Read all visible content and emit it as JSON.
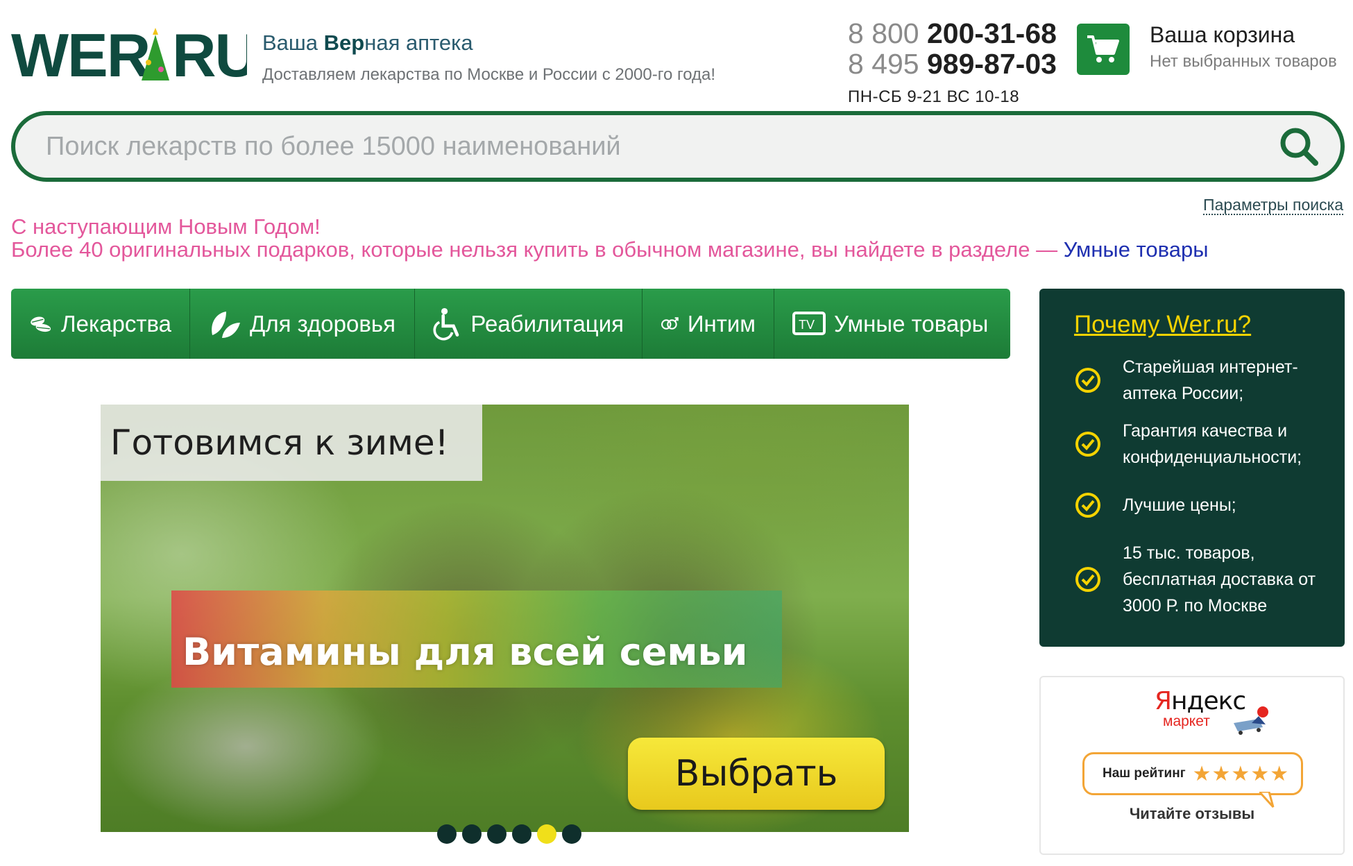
{
  "header": {
    "logo_text": "WER.RU",
    "tagline_prefix": "Ваша ",
    "tagline_bold": "Вер",
    "tagline_suffix": "ная аптека",
    "subtitle": "Доставляем лекарства по Москве и России с 2000-го года!",
    "phones": [
      {
        "prefix": "8 800 ",
        "number": "200-31-68"
      },
      {
        "prefix": "8 495 ",
        "number": "989-87-03"
      }
    ],
    "hours": "ПН-СБ 9-21 ВС 10-18",
    "cart": {
      "title": "Ваша корзина",
      "status": "Нет выбранных товаров"
    }
  },
  "search": {
    "placeholder": "Поиск лекарств по более 15000 наименований",
    "value": "",
    "params_link": "Параметры поиска"
  },
  "promo": {
    "line1": "С наступающим Новым Годом!",
    "line2": "Более 40 оригинальных подарков, которые нельзя купить в обычном магазине, вы найдете в разделе — ",
    "link": "Умные товары"
  },
  "nav": {
    "items": [
      {
        "label": "Лекарства",
        "icon": "pills-icon"
      },
      {
        "label": "Для здоровья",
        "icon": "leaves-icon"
      },
      {
        "label": "Реабилитация",
        "icon": "wheelchair-icon"
      },
      {
        "label": "Интим",
        "icon": "gender-rings-icon"
      },
      {
        "label": "Умные товары",
        "icon": "tv-icon"
      }
    ]
  },
  "banner": {
    "corner_text": "Готовимся к зиме!",
    "headline": "Витамины для всей семьи",
    "cta": "Выбрать",
    "slide_count": 6,
    "active_slide": 5
  },
  "why": {
    "title": "Почему Wer.ru?",
    "items": [
      "Старейшая интернет-аптека России;",
      "Гарантия качества и конфиденциальности;",
      "Лучшие цены;",
      "15 тыс. товаров, бесплатная доставка от 3000 Р. по Москве"
    ]
  },
  "yandex": {
    "logo_first": "Я",
    "logo_rest": "ндекс",
    "logo_sub": "маркет",
    "rating_label": "Наш рейтинг",
    "stars": "★★★★★",
    "rating": 5,
    "link": "Читайте отзывы"
  },
  "colors": {
    "brand_green": "#1e8b3c",
    "dark_green": "#0f3b32",
    "accent_yellow": "#f5d300",
    "promo_pink": "#e3579b",
    "link_blue": "#1e2fb0"
  }
}
